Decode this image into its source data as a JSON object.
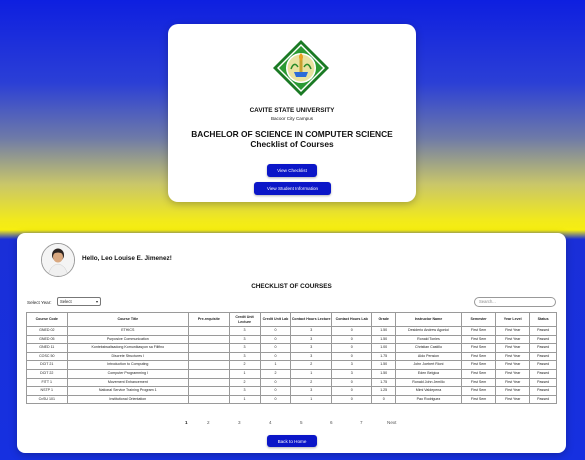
{
  "header": {
    "university": "CAVITE STATE UNIVERSITY",
    "campus": "Bacoor City Campus",
    "degree": "BACHELOR OF SCIENCE IN COMPUTER SCIENCE",
    "subtitle": "Checklist of Courses",
    "view_checklist_label": "View Checklist",
    "view_student_info_label": "View Student Information"
  },
  "student": {
    "greeting": "Hello, Leo Louise E. Jimenez!"
  },
  "checklist": {
    "title": "CHECKLIST OF COURSES",
    "year_label": "Select Year:",
    "year_selected": "Select",
    "search_placeholder": "Search...",
    "columns": [
      "Course Code",
      "Course Title",
      "Pre-requisite",
      "Credit Unit Lecture",
      "Credit Unit Lab",
      "Contact Hours Lecture",
      "Contact Hours Lab",
      "Grade",
      "Instructor Name",
      "Semester",
      "Year Level",
      "Status"
    ],
    "rows": [
      [
        "GNED 02",
        "ETHICS",
        "",
        "3",
        "0",
        "3",
        "0",
        "1.50",
        "Desiderio Andrew Agonioi",
        "First Sem",
        "First Year",
        "Passed"
      ],
      [
        "GNED 05",
        "Purposive Communication",
        "",
        "3",
        "0",
        "3",
        "0",
        "1.50",
        "Ronald Tonies",
        "First Sem",
        "First Year",
        "Passed"
      ],
      [
        "GNED 11",
        "Kontekstwalisadong Komunikasyon sa Filifino",
        "",
        "3",
        "0",
        "3",
        "0",
        "1.00",
        "Christian Castillo",
        "First Sem",
        "First Year",
        "Passed"
      ],
      [
        "COSC 50",
        "Discrete Structures I",
        "",
        "3",
        "0",
        "3",
        "0",
        "1.75",
        "Aldo Pension",
        "First Sem",
        "First Year",
        "Passed"
      ],
      [
        "DCIT 21",
        "Introduction to Computing",
        "",
        "2",
        "1",
        "2",
        "3",
        "1.50",
        "John Joebert Rioni",
        "First Sem",
        "First Year",
        "Passed"
      ],
      [
        "DCIT 22",
        "Computer Programming I",
        "",
        "1",
        "2",
        "1",
        "3",
        "1.50",
        "Eden Belgica",
        "First Sem",
        "First Year",
        "Passed"
      ],
      [
        "FITT 1",
        "Movement Enhancement",
        "",
        "2",
        "0",
        "2",
        "0",
        "1.75",
        "Ronald John Jemillo",
        "First Sem",
        "First Year",
        "Passed"
      ],
      [
        "NSTP 1",
        "National Service Training Program 1",
        "",
        "3",
        "0",
        "3",
        "0",
        "1.25",
        "Mimi Valdepena",
        "First Sem",
        "First Year",
        "Passed"
      ],
      [
        "CvSU 101",
        "Institutional Orientation",
        "",
        "1",
        "0",
        "1",
        "0",
        "0",
        "Pao Rodriguez",
        "First Sem",
        "First Year",
        "Passed"
      ]
    ],
    "pages": [
      "1",
      "2",
      "3",
      "4",
      "5",
      "6",
      "7",
      "Next"
    ],
    "back_label": "Back to Home"
  },
  "colors": {
    "button_blue": "#0b16c8",
    "bg_blue": "#1630e0",
    "bg_yellow": "#f6ee10",
    "seal_green": "#1f8a2a"
  }
}
